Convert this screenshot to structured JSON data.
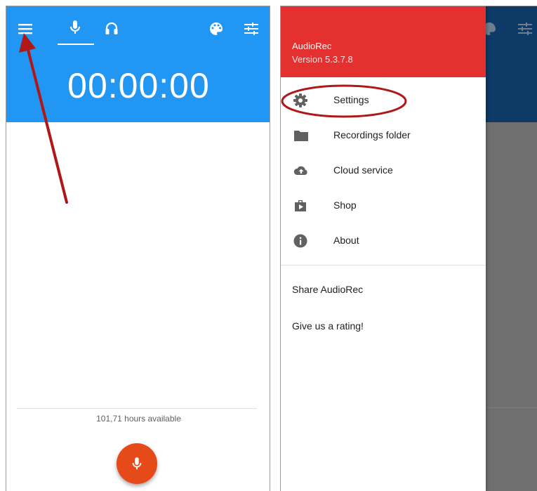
{
  "left_screen": {
    "toolbar": {
      "menu_icon": "menu-icon",
      "tabs": [
        {
          "icon": "microphone-icon",
          "active": true
        },
        {
          "icon": "headphones-icon",
          "active": false
        }
      ],
      "actions": [
        "palette-icon",
        "tune-icon"
      ]
    },
    "timer": "00:00:00",
    "available": "101,71 hours available",
    "record_button_icon": "microphone-icon"
  },
  "right_screen": {
    "drawer": {
      "app_name": "AudioRec",
      "version": "Version 5.3.7.8",
      "items": [
        {
          "label": "Settings",
          "icon": "gear-icon"
        },
        {
          "label": "Recordings folder",
          "icon": "folder-icon"
        },
        {
          "label": "Cloud service",
          "icon": "cloud-upload-icon"
        },
        {
          "label": "Shop",
          "icon": "shop-icon"
        },
        {
          "label": "About",
          "icon": "info-icon"
        }
      ],
      "secondary": [
        "Share AudioRec",
        "Give us a rating!"
      ]
    }
  },
  "colors": {
    "appbar": "#2196f3",
    "drawer_header": "#e53030",
    "fab": "#e64a19",
    "annotation": "#b01818"
  }
}
